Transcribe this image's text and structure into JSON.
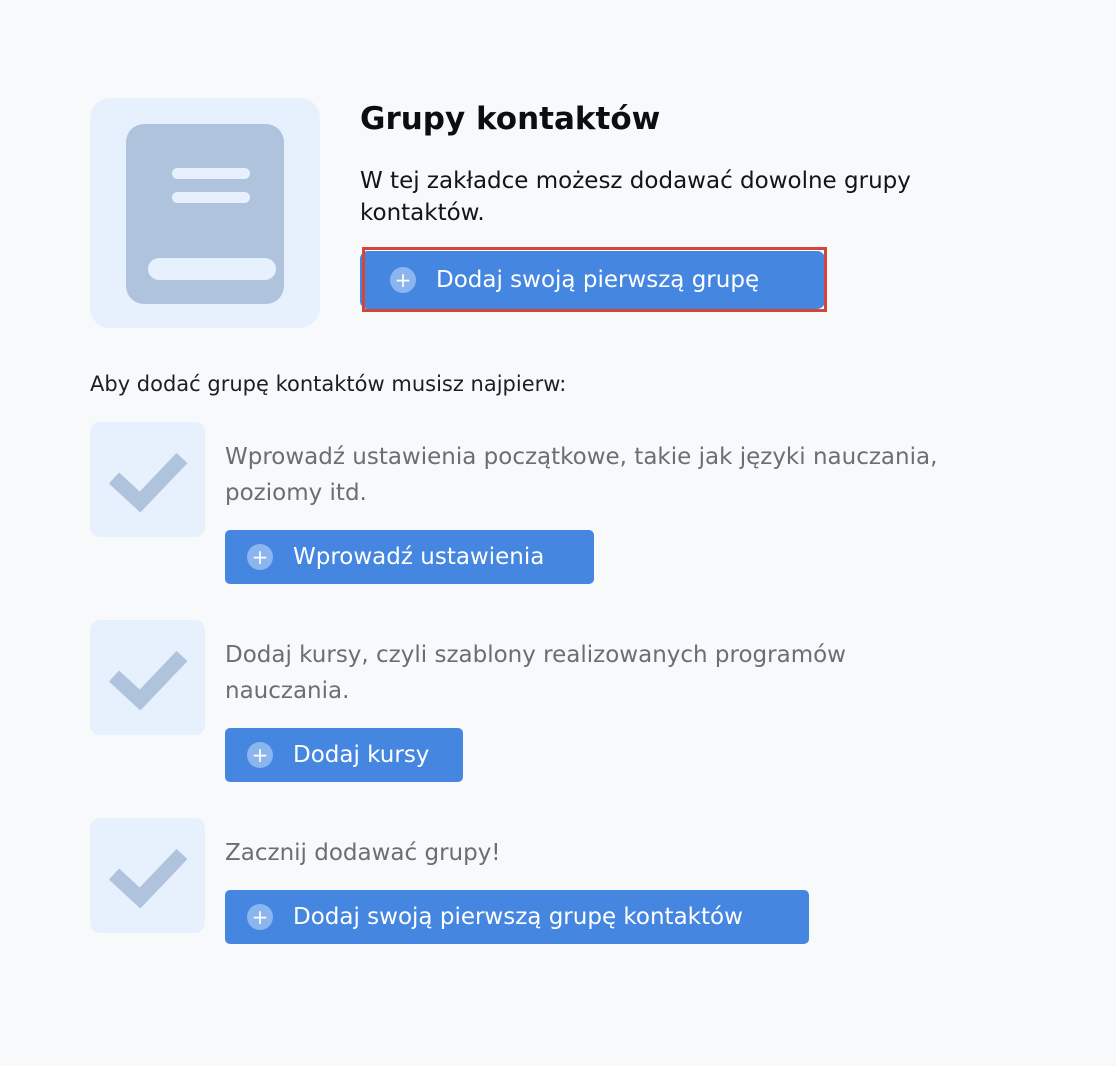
{
  "header": {
    "title": "Grupy kontaktów",
    "description": "W tej zakładce możesz dodawać dowolne grupy kontaktów.",
    "primary_button_label": "Dodaj swoją pierwszą grupę",
    "hero_icon": "book-icon"
  },
  "requirements": {
    "intro": "Aby dodać grupę kontaktów musisz najpierw:",
    "steps": [
      {
        "text": "Wprowadź ustawienia początkowe, takie jak języki nauczania, poziomy itd.",
        "button_label": "Wprowadź ustawienia",
        "icon": "checkmark-icon"
      },
      {
        "text": "Dodaj kursy, czyli szablony realizowanych programów nauczania.",
        "button_label": "Dodaj kursy",
        "icon": "checkmark-icon"
      },
      {
        "text": "Zacznij dodawać grupy!",
        "button_label": "Dodaj swoją pierwszą grupę kontaktów",
        "icon": "checkmark-icon"
      }
    ]
  },
  "button_icon": "plus-circle-icon",
  "colors": {
    "page_background": "#f8f9fb",
    "tile_background": "#e7f1fd",
    "icon_fill": "#b0c3dc",
    "button_background": "#4486e0",
    "highlight_border": "#d6453a",
    "step_text": "#6a6e75"
  }
}
